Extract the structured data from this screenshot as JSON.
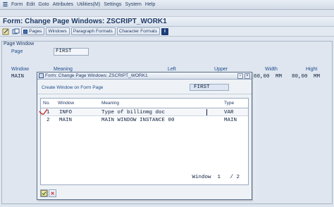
{
  "menubar": {
    "items": [
      "Form",
      "Edit",
      "Goto",
      "Attributes",
      "Utilities(M)",
      "Settings",
      "System",
      "Help"
    ]
  },
  "title": "Form: Change Page Windows: ZSCRIPT_WORK1",
  "toolbar": {
    "buttons": [
      "Pages",
      "Windows",
      "Paragraph Formats",
      "Character Formats"
    ]
  },
  "page_window": {
    "group_title": "Page Window",
    "page_label": "Page",
    "page_value": "FIRST",
    "columns": {
      "window": "Window",
      "meaning": "Meaning",
      "left": "Left",
      "upper": "Upper",
      "width": "Width",
      "height": "Hight"
    },
    "row": {
      "window": "MAIN",
      "width": "60,00",
      "width_unit": "MM",
      "height": "80,00",
      "height_unit": "MM"
    }
  },
  "dialog": {
    "title": "Form: Change Page Windows: ZSCRIPT_WORK1",
    "create_label": "Create Window on Form Page",
    "create_value": "FIRST",
    "headers": {
      "no": "No.",
      "window": "Window",
      "meaning": "Meaning",
      "type": "Type"
    },
    "rows": [
      {
        "no": "1",
        "window": "INFO",
        "meaning": "Type of billinmg doc",
        "type": "VAR"
      },
      {
        "no": "2",
        "window": "MAIN",
        "meaning": "MAIN WINDOW INSTANCE 00",
        "type": "MAIN"
      }
    ],
    "footer": "Window  1   / 2"
  }
}
